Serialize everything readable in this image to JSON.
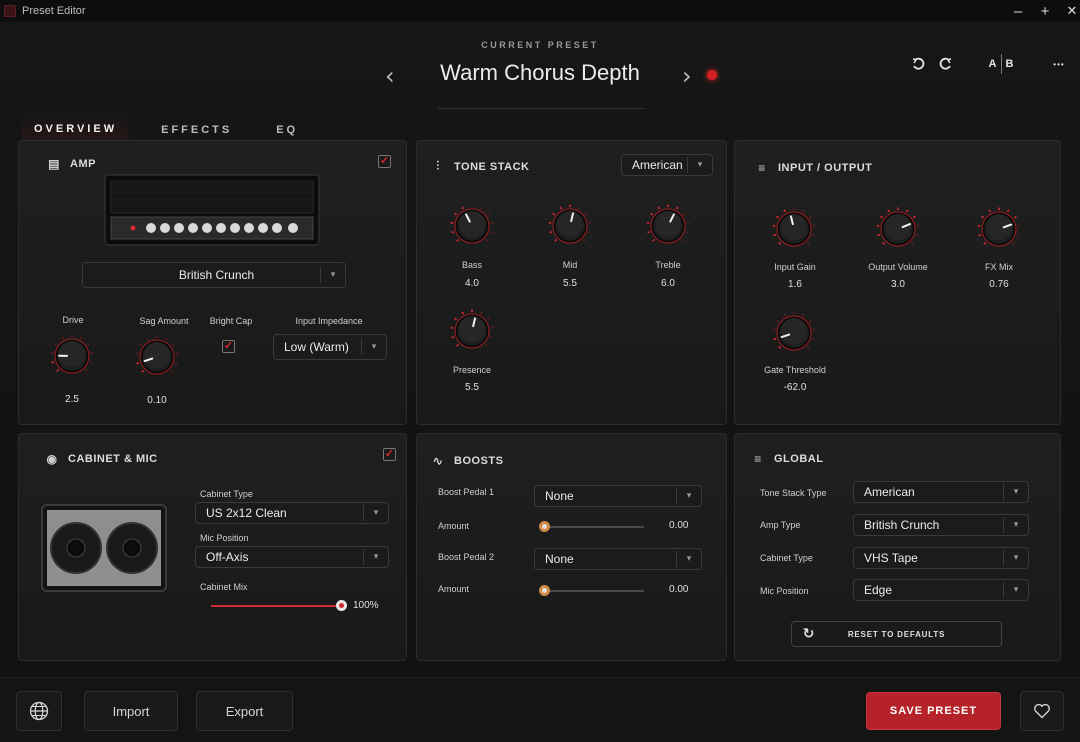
{
  "window": {
    "title": "Preset Editor",
    "minimize": "–",
    "maximize": "+",
    "close": "✕"
  },
  "header": {
    "current_preset_label": "CURRENT PRESET",
    "preset_name": "Warm Chorus Depth",
    "prev": "‹",
    "next": "›",
    "ab_a": "A",
    "ab_b": "B",
    "more": "•••"
  },
  "tabs": [
    "OVERVIEW",
    "EFFECTS",
    "EQ"
  ],
  "amp": {
    "title": "AMP",
    "enabled": true,
    "model": "British Crunch",
    "drive_label": "Drive",
    "drive_value": "2.5",
    "sag_label": "Sag Amount",
    "sag_value": "0.10",
    "bright_label": "Bright Cap",
    "bright": true,
    "impedance_label": "Input Impedance",
    "impedance": "Low (Warm)"
  },
  "tone_stack": {
    "title": "TONE STACK",
    "type": "American",
    "bass_label": "Bass",
    "bass": "4.0",
    "mid_label": "Mid",
    "mid": "5.5",
    "treble_label": "Treble",
    "treble": "6.0",
    "presence_label": "Presence",
    "presence": "5.5"
  },
  "io": {
    "title": "INPUT / OUTPUT",
    "input_gain_label": "Input Gain",
    "input_gain": "1.6",
    "output_volume_label": "Output Volume",
    "output_volume": "3.0",
    "fx_mix_label": "FX Mix",
    "fx_mix": "0.76",
    "gate_label": "Gate Threshold",
    "gate": "-62.0"
  },
  "cabinet": {
    "title": "CABINET & MIC",
    "enabled": true,
    "type_label": "Cabinet Type",
    "type": "US 2x12 Clean",
    "mic_label": "Mic Position",
    "mic": "Off-Axis",
    "mix_label": "Cabinet Mix",
    "mix": "100%",
    "mix_level": 1.0
  },
  "boosts": {
    "title": "BOOSTS",
    "pedal1_label": "Boost Pedal 1",
    "pedal1": "None",
    "amount1_label": "Amount",
    "amount1": "0.00",
    "pedal2_label": "Boost Pedal 2",
    "pedal2": "None",
    "amount2_label": "Amount",
    "amount2": "0.00"
  },
  "global": {
    "title": "GLOBAL",
    "tone_stack_type_label": "Tone Stack Type",
    "tone_stack_type": "American",
    "amp_type_label": "Amp Type",
    "amp_type": "British Crunch",
    "cabinet_type_label": "Cabinet Type",
    "cabinet_type": "VHS Tape",
    "mic_position_label": "Mic Position",
    "mic_position": "Edge",
    "reset_label": "RESET TO DEFAULTS"
  },
  "footer": {
    "import": "Import",
    "export": "Export",
    "save": "SAVE PRESET"
  },
  "knob_levels": {
    "drive": 0.17,
    "sag": 0.1,
    "bass": 0.4,
    "mid": 0.55,
    "treble": 0.6,
    "presence": 0.55,
    "input_gain": 0.45,
    "output_volume": 0.75,
    "fx_mix": 0.76,
    "gate": 0.1
  },
  "colors": {
    "accent": "#c8242a",
    "panel": "#1d1d1d",
    "background": "#121212"
  }
}
